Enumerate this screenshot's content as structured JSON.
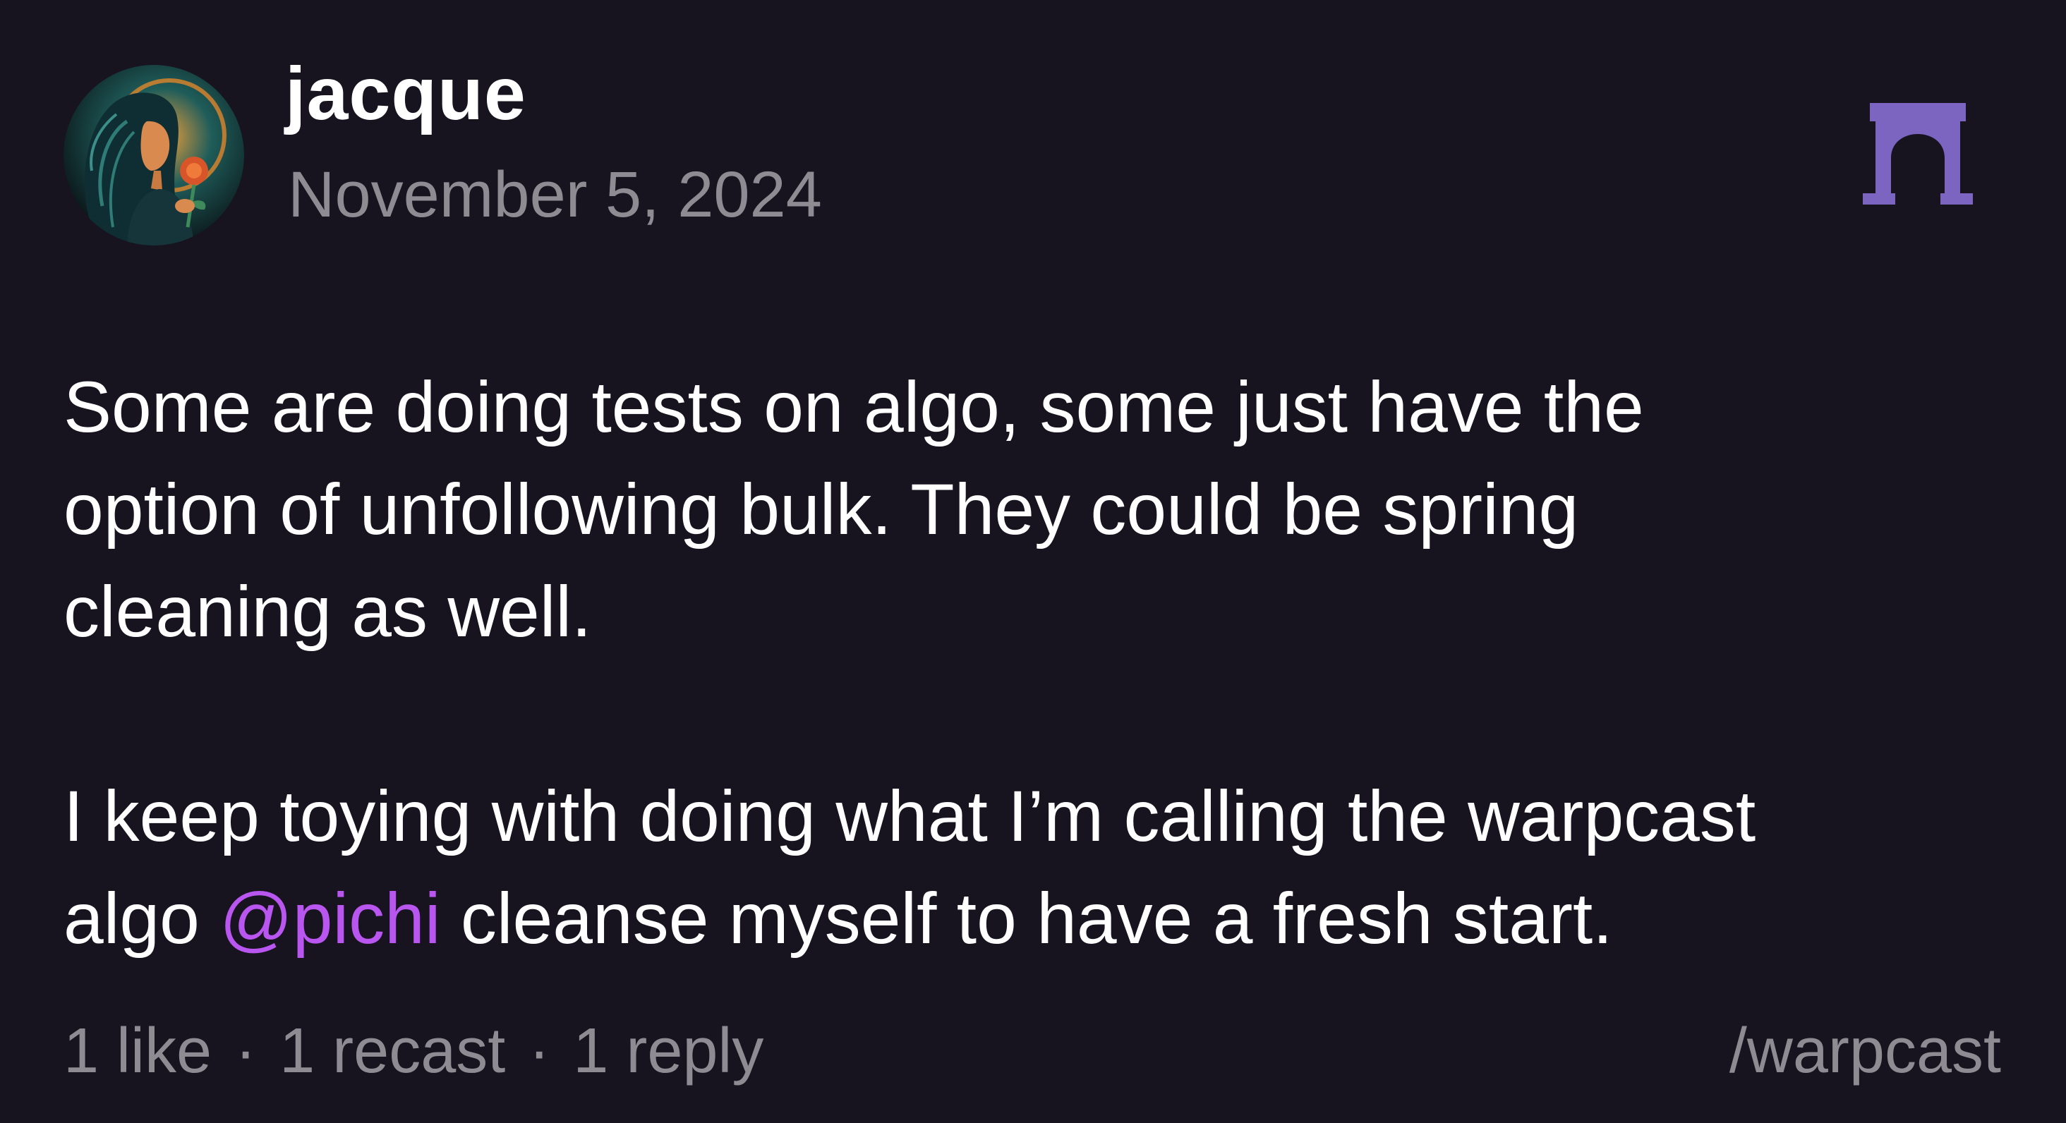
{
  "author": {
    "name": "jacque",
    "date": "November 5, 2024",
    "avatar_icon": "portrait-woman-with-rose-avatar"
  },
  "brand": {
    "icon": "farcaster-arch-icon",
    "color": "#7c65c1"
  },
  "post": {
    "paragraph1": "Some are doing tests on algo, some just have the option of unfollowing bulk. They could be spring cleaning as well.",
    "paragraph2_line1": "I keep toying with doing what I’m calling the warpcast",
    "paragraph2_prefix": "algo ",
    "mention": "@pichi",
    "paragraph2_suffix": " cleanse myself to have a fresh start.",
    "mention_color": "#b956f0"
  },
  "stats": {
    "likes": "1 like",
    "recasts": "1 recast",
    "replies": "1 reply",
    "separator": "·"
  },
  "channel": "/warpcast",
  "colors": {
    "background": "#17131f",
    "text": "#ffffff",
    "muted": "#8e8c92"
  }
}
